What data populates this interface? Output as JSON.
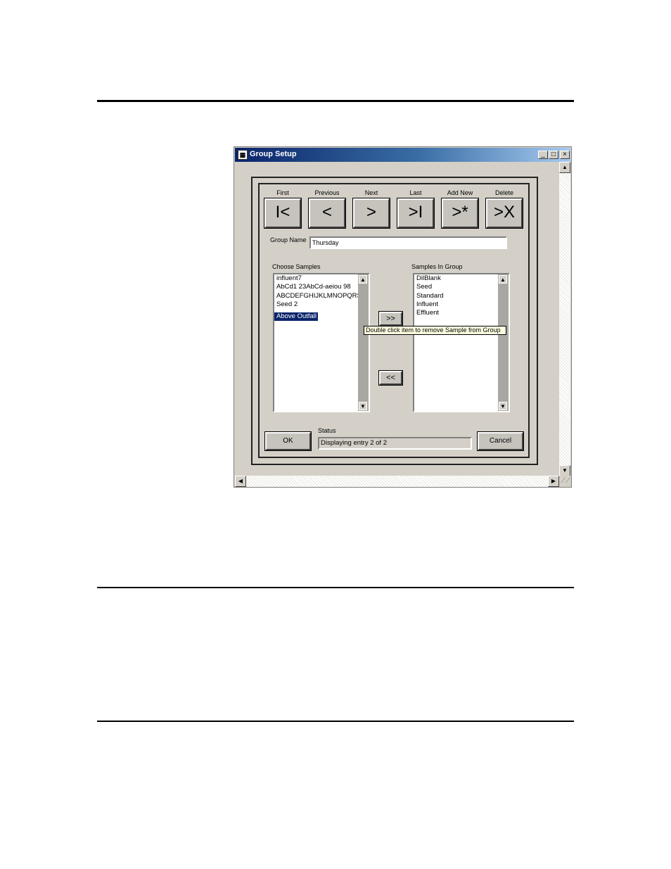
{
  "window": {
    "title": "Group Setup",
    "icon": "app-icon",
    "controls": {
      "minimize": "_",
      "maximize": "□",
      "close": "×"
    }
  },
  "navigation": [
    {
      "label": "First",
      "symbol": "I<"
    },
    {
      "label": "Previous",
      "symbol": "<"
    },
    {
      "label": "Next",
      "symbol": ">"
    },
    {
      "label": "Last",
      "symbol": ">I"
    },
    {
      "label": "Add New",
      "symbol": ">*"
    },
    {
      "label": "Delete",
      "symbol": ">X"
    }
  ],
  "group_name": {
    "label": "Group Name",
    "value": "Thursday"
  },
  "choose_samples": {
    "label": "Choose Samples",
    "items": [
      "influent7",
      "AbCd1 23AbCd-aeiou 98",
      "ABCDEFGHIJKLMNOPQRST",
      "Seed 2",
      "Above Outfall"
    ],
    "selected_index": 4
  },
  "samples_in_group": {
    "label": "Samples In Group",
    "items": [
      "DilBlank",
      "Seed",
      "Standard",
      "Influent",
      "Effluent"
    ]
  },
  "move_buttons": {
    "add": ">>",
    "remove": "<<"
  },
  "tooltip": "Double click  item to remove Sample from Group",
  "status": {
    "label": "Status",
    "value": "Displaying entry 2 of 2"
  },
  "buttons": {
    "ok": "OK",
    "cancel": "Cancel"
  },
  "scroll_arrows": {
    "up": "▲",
    "down": "▼",
    "left": "◀",
    "right": "▶"
  }
}
